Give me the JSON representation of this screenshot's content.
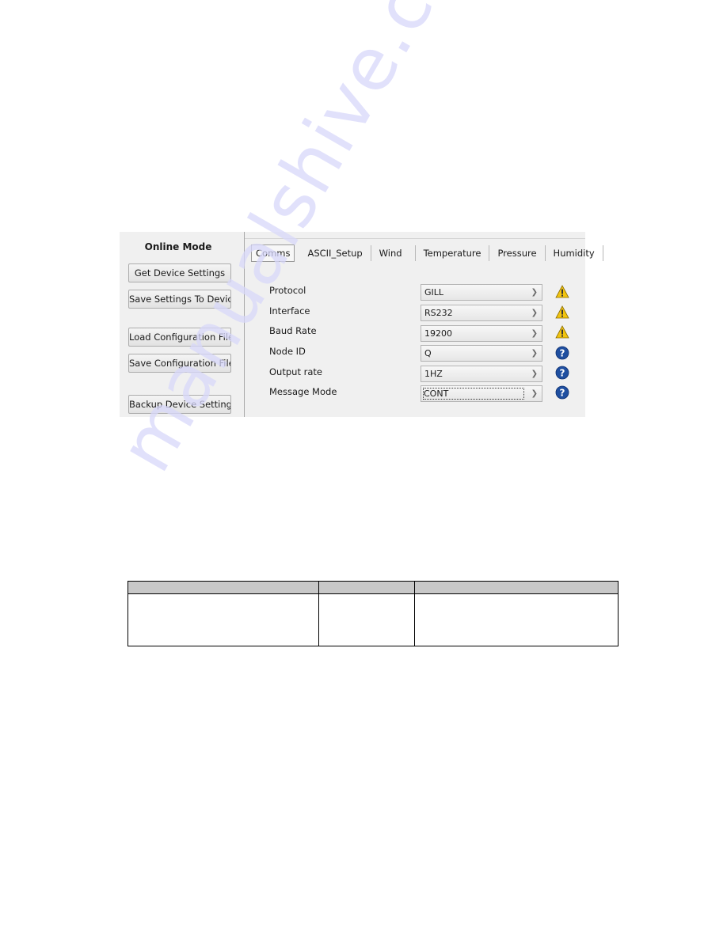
{
  "online_mode": {
    "title": "Online Mode",
    "buttons": [
      {
        "label": "Get Device Settings"
      },
      {
        "label": "Save Settings To Device"
      },
      {
        "label": "Load Configuration File"
      },
      {
        "label": "Save Configuration File"
      },
      {
        "label": "Backup Device Settings"
      }
    ]
  },
  "tabs": [
    {
      "label": "Comms",
      "active": true
    },
    {
      "label": "ASCII_Setup",
      "active": false
    },
    {
      "label": "Wind",
      "active": false
    },
    {
      "label": "Temperature",
      "active": false
    },
    {
      "label": "Pressure",
      "active": false
    },
    {
      "label": "Humidity",
      "active": false
    }
  ],
  "comms": {
    "fields": [
      {
        "label": "Protocol",
        "value": "GILL",
        "status_icon": "warning-icon"
      },
      {
        "label": "Interface",
        "value": "RS232",
        "status_icon": "warning-icon"
      },
      {
        "label": "Baud Rate",
        "value": "19200",
        "status_icon": "warning-icon"
      },
      {
        "label": "Node ID",
        "value": "Q",
        "status_icon": "help-icon"
      },
      {
        "label": "Output rate",
        "value": "1HZ",
        "status_icon": "help-icon"
      },
      {
        "label": "Message Mode",
        "value": "CONT",
        "status_icon": "help-icon"
      }
    ]
  },
  "table": {
    "headers": [
      "",
      "",
      ""
    ],
    "rows": [
      [
        "",
        "",
        ""
      ]
    ]
  },
  "watermark": "manualshive.com",
  "colors": {
    "warning": "#f2c40f",
    "help": "#1f4fa0",
    "panel_bg": "#f0f0f0",
    "table_header_bg": "#c8c8c8",
    "watermark": "#d8d8fa"
  }
}
